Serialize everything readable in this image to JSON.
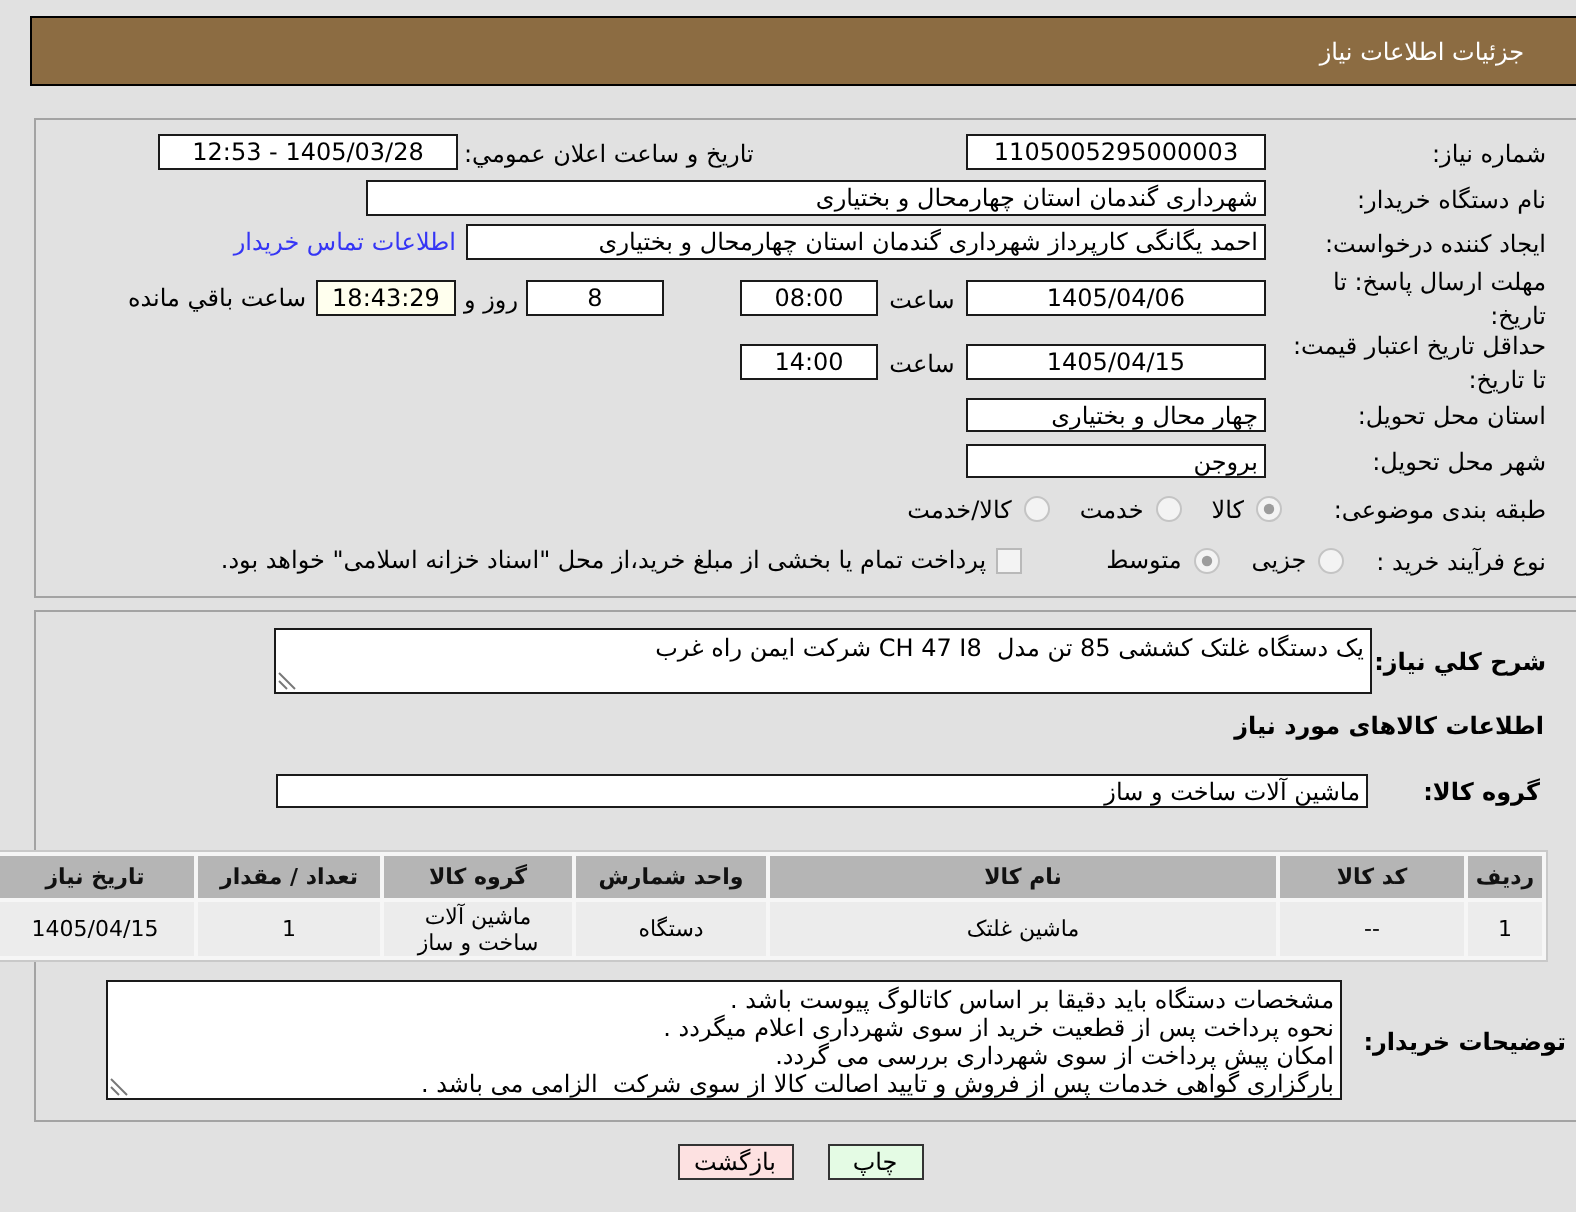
{
  "header": {
    "title": "جزئیات اطلاعات نیاز"
  },
  "details": {
    "need_number": {
      "label": "شماره نیاز:",
      "value": "1105005295000003"
    },
    "announced": {
      "label": "تاریخ و ساعت اعلان عمومي:",
      "value": "1405/03/28 - 12:53"
    },
    "buyer": {
      "label": "نام دستگاه خریدار:",
      "value": "شهرداری گندمان استان چهارمحال و بختیاری"
    },
    "requester": {
      "label": "ایجاد کننده درخواست:",
      "value": "احمد یگانگی کارپرداز شهرداری گندمان استان چهارمحال و بختیاری",
      "contact_link": "اطلاعات تماس خریدار"
    },
    "reply_deadline": {
      "label": "مهلت ارسال پاسخ: تا تاریخ:",
      "date": "1405/04/06",
      "time_label": "ساعت",
      "time": "08:00",
      "days": "8",
      "days_label": "روز و",
      "remaining": "18:43:29",
      "remaining_label": "ساعت باقي مانده"
    },
    "price_validity": {
      "label": "حداقل تاریخ اعتبار قیمت: تا تاریخ:",
      "date": "1405/04/15",
      "time_label": "ساعت",
      "time": "14:00"
    },
    "delivery_province": {
      "label": "استان محل تحویل:",
      "value": "چهار محال و بختیاری"
    },
    "delivery_city": {
      "label": "شهر محل تحویل:",
      "value": "بروجن"
    },
    "category": {
      "label": "طبقه بندی موضوعی:",
      "options": [
        {
          "label": "کالا",
          "selected": true
        },
        {
          "label": "خدمت",
          "selected": false
        },
        {
          "label": "کالا/خدمت",
          "selected": false
        }
      ]
    },
    "purchase_process": {
      "label": "نوع فرآیند خرید :",
      "options": [
        {
          "label": "جزیی",
          "selected": false
        },
        {
          "label": "متوسط",
          "selected": true
        }
      ],
      "treasury_payment": {
        "label": "پرداخت تمام یا بخشی از مبلغ خرید،از محل \"اسناد خزانه اسلامی\" خواهد بود.",
        "checked": false
      }
    }
  },
  "summary": {
    "label": "شرح کلي نیاز:",
    "value": "یک دستگاه غلتک کششی 85 تن مدل  CH 47 I8 شرکت ایمن راه غرب"
  },
  "goods": {
    "title": "اطلاعات کالاهای مورد نیاز",
    "group": {
      "label": "گروه کالا:",
      "value": "ماشین آلات ساخت و ساز"
    },
    "table": {
      "columns": [
        "ردیف",
        "کد کالا",
        "نام کالا",
        "واحد شمارش",
        "گروه کالا",
        "تعداد / مقدار",
        "تاریخ نیاز"
      ],
      "rows": [
        [
          "1",
          "--",
          "ماشین غلتک",
          "دستگاه",
          "ماشین آلات ساخت و ساز",
          "1",
          "1405/04/15"
        ]
      ]
    }
  },
  "buyer_notes": {
    "label": "توضیحات خریدار:",
    "value": "مشخصات دستگاه باید دقیقا بر اساس کاتالوگ پیوست باشد .\nنحوه پرداخت پس از قطعیت خرید از سوی شهرداری اعلام میگردد .\nامکان پیش پرداخت از سوی شهرداری بررسی می گردد.\nبارگزاری گواهی خدمات پس از فروش و تایید اصالت کالا از سوی شرکت  الزامی می باشد ."
  },
  "buttons": [
    {
      "label": "چاپ",
      "kind": "print"
    },
    {
      "label": "بازگشت",
      "kind": "back"
    }
  ]
}
